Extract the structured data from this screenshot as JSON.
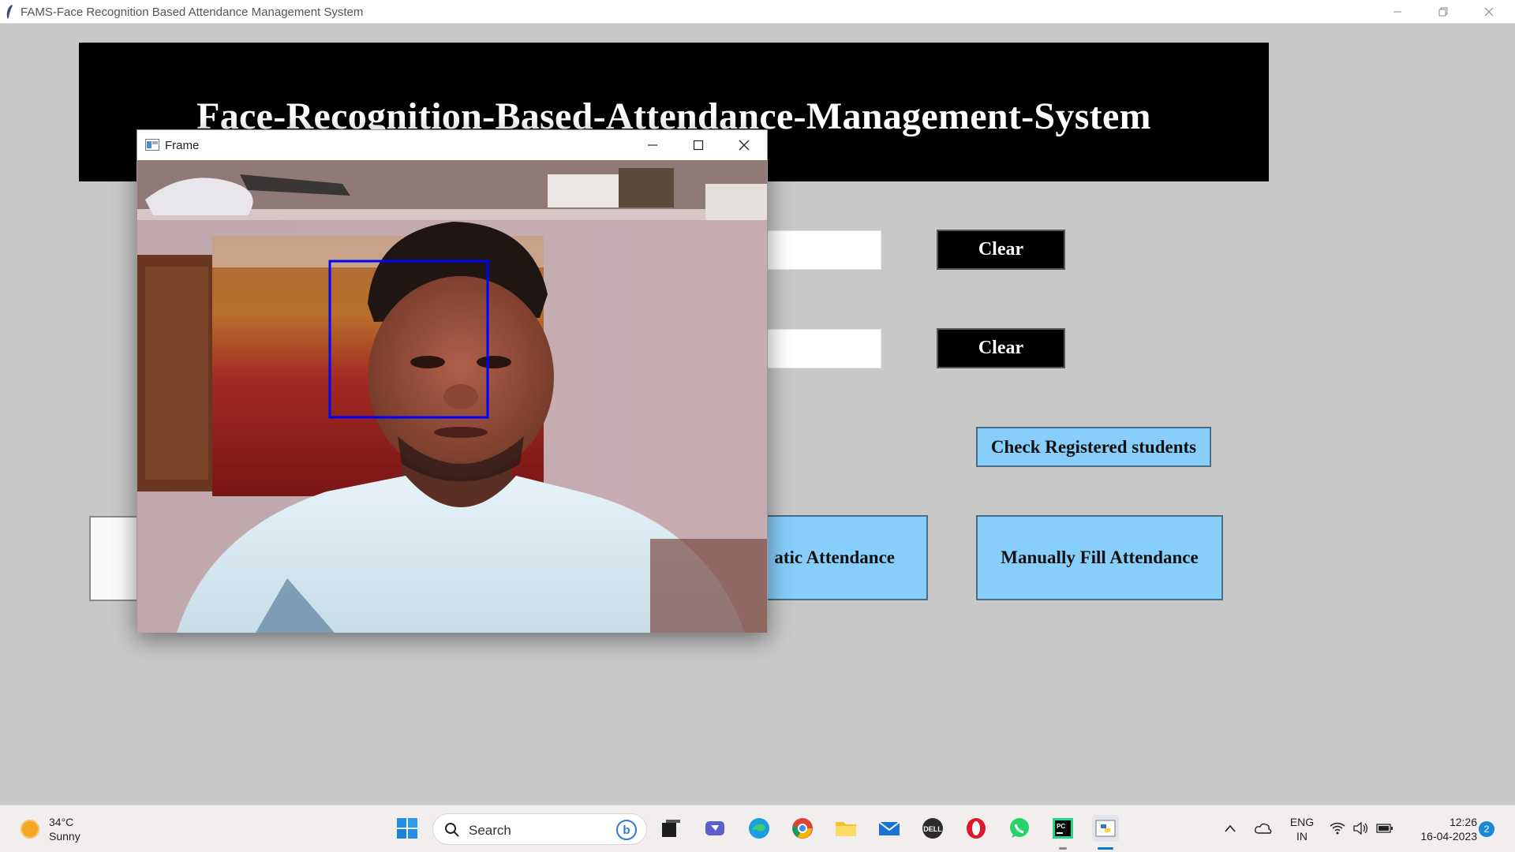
{
  "main_window": {
    "title": "FAMS-Face Recognition Based Attendance Management System",
    "banner_title": "Face-Recognition-Based-Attendance-Management-System"
  },
  "buttons": {
    "clear_1": "Clear",
    "clear_2": "Clear",
    "check_registered": "Check Registered students",
    "automatic_attendance_visible": "atic Attendance",
    "manual_attendance": "Manually Fill Attendance"
  },
  "frame_window": {
    "title": "Frame"
  },
  "taskbar": {
    "weather": {
      "temp": "34°C",
      "condition": "Sunny"
    },
    "search_placeholder": "Search",
    "bing_label": "b",
    "pinned_apps": [
      "start-icon",
      "search-icon",
      "task-view-icon",
      "teams-icon",
      "edge-icon",
      "chrome-icon",
      "file-explorer-icon",
      "mail-icon",
      "dell-icon",
      "opera-icon",
      "whatsapp-icon",
      "pycharm-icon",
      "python-icon"
    ],
    "language": {
      "line1": "ENG",
      "line2": "IN"
    },
    "clock": {
      "time": "12:26",
      "date": "16-04-2023"
    },
    "notification_count": "2"
  }
}
